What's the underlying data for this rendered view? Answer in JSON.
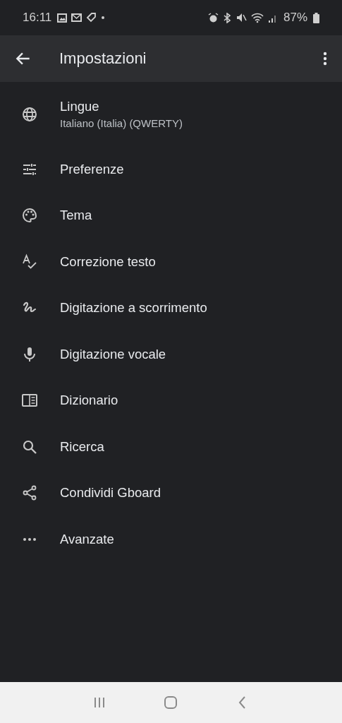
{
  "status_bar": {
    "time": "16:11",
    "battery": "87%"
  },
  "app_bar": {
    "title": "Impostazioni"
  },
  "items": [
    {
      "label": "Lingue",
      "subtitle": "Italiano (Italia) (QWERTY)"
    },
    {
      "label": "Preferenze"
    },
    {
      "label": "Tema"
    },
    {
      "label": "Correzione testo"
    },
    {
      "label": "Digitazione a scorrimento"
    },
    {
      "label": "Digitazione vocale"
    },
    {
      "label": "Dizionario"
    },
    {
      "label": "Ricerca"
    },
    {
      "label": "Condividi Gboard"
    },
    {
      "label": "Avanzate"
    }
  ]
}
